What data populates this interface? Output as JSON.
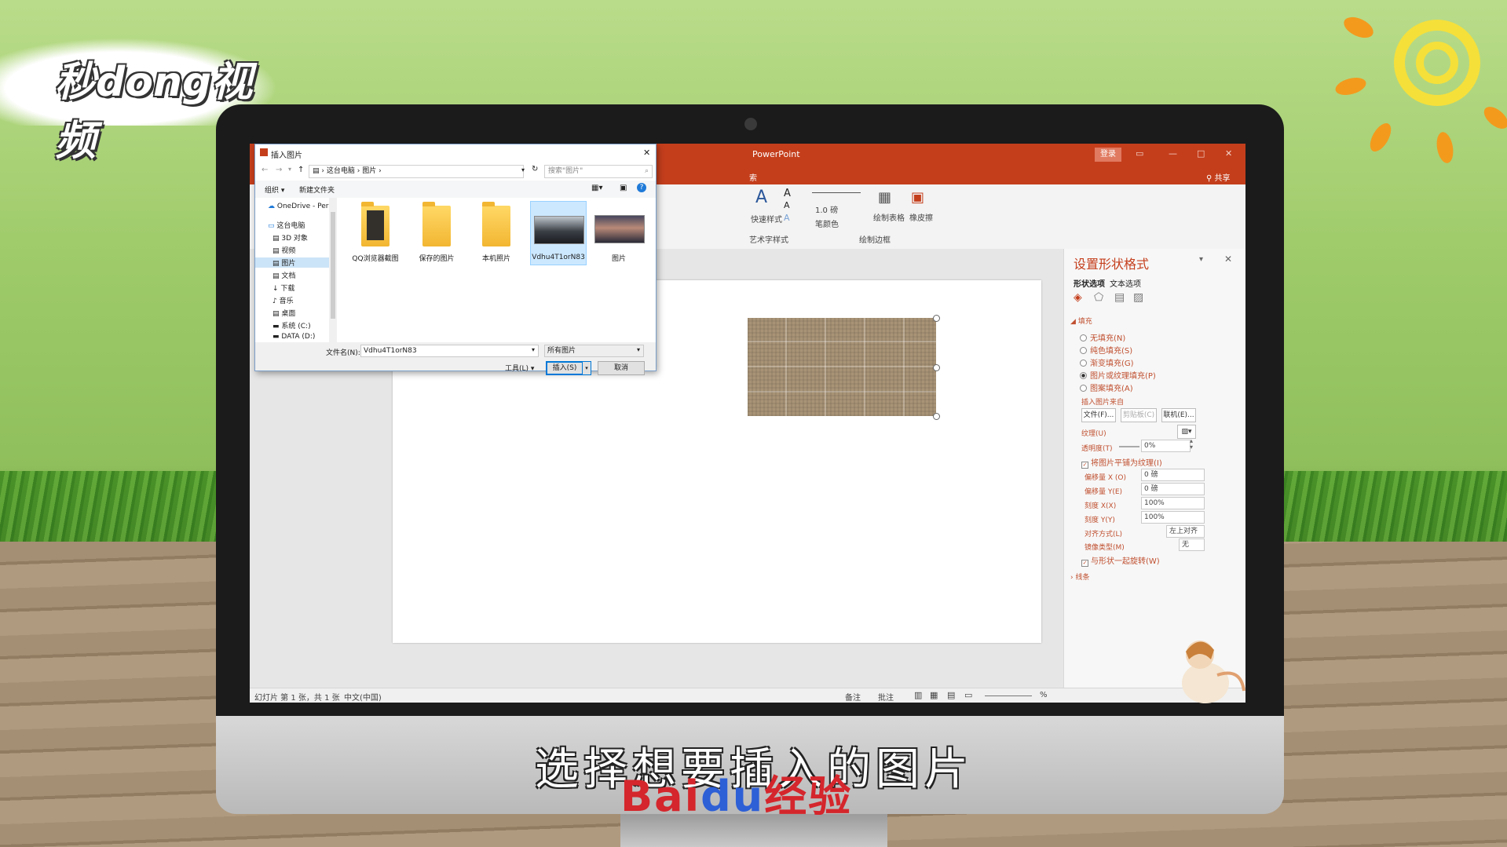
{
  "watermark": {
    "logo": "秒dong视频",
    "subtitle": "选择想要插入的图片",
    "brand_bai": "Bai",
    "brand_du": "du",
    "brand_jingyan": "经验"
  },
  "powerpoint": {
    "app_title": "PowerPoint",
    "login_label": "登录",
    "share_label": "共享",
    "tab_partial": "索",
    "ribbon": {
      "quick_styles": "快速样式",
      "wordart_group": "艺术字样式",
      "line_weight": "1.0 磅",
      "pen_color": "笔颜色",
      "draw_table": "绘制表格",
      "eraser": "橡皮擦",
      "draw_border_group": "绘制边框"
    },
    "status": {
      "slide_info": "幻灯片 第 1 张，共 1 张",
      "language": "中文(中国)",
      "notes": "备注",
      "comments": "批注",
      "zoom": "%"
    }
  },
  "format_pane": {
    "title": "设置形状格式",
    "tabs": [
      "形状选项",
      "文本选项"
    ],
    "section_fill": "填充",
    "fill_options": [
      {
        "label": "无填充(N)",
        "selected": false
      },
      {
        "label": "纯色填充(S)",
        "selected": false
      },
      {
        "label": "渐变填充(G)",
        "selected": false
      },
      {
        "label": "图片或纹理填充(P)",
        "selected": true
      },
      {
        "label": "图案填充(A)",
        "selected": false
      }
    ],
    "insert_from": "插入图片来自",
    "buttons": {
      "file": "文件(F)...",
      "clipboard": "剪贴板(C)",
      "online": "联机(E)..."
    },
    "texture_label": "纹理(U)",
    "transparency_label": "透明度(T)",
    "transparency_value": "0%",
    "tile_label": "将图片平铺为纹理(I)",
    "offset_x_label": "偏移量 X (O)",
    "offset_x_value": "0 磅",
    "offset_y_label": "偏移量 Y(E)",
    "offset_y_value": "0 磅",
    "scale_x_label": "刻度 X(X)",
    "scale_x_value": "100%",
    "scale_y_label": "刻度 Y(Y)",
    "scale_y_value": "100%",
    "align_label": "对齐方式(L)",
    "align_value": "左上对齐",
    "mirror_label": "镜像类型(M)",
    "mirror_value": "无",
    "rotate_label": "与形状一起旋转(W)",
    "section_line": "线条"
  },
  "dialog": {
    "title": "插入图片",
    "breadcrumb": [
      "这台电脑",
      "图片"
    ],
    "search_placeholder": "搜索\"图片\"",
    "organize": "组织",
    "new_folder": "新建文件夹",
    "tree": [
      "OneDrive - Persc",
      "这台电脑",
      "3D 对象",
      "视频",
      "图片",
      "文档",
      "下载",
      "音乐",
      "桌面",
      "系统 (C:)",
      "DATA (D:)"
    ],
    "items": [
      "QQ浏览器截图",
      "保存的图片",
      "本机照片",
      "Vdhu4T1orN83",
      "图片"
    ],
    "filename_label": "文件名(N):",
    "filename_value": "Vdhu4T1orN83",
    "filetype_value": "所有图片",
    "tools_label": "工具(L)",
    "insert_label": "插入(S)",
    "cancel_label": "取消"
  }
}
